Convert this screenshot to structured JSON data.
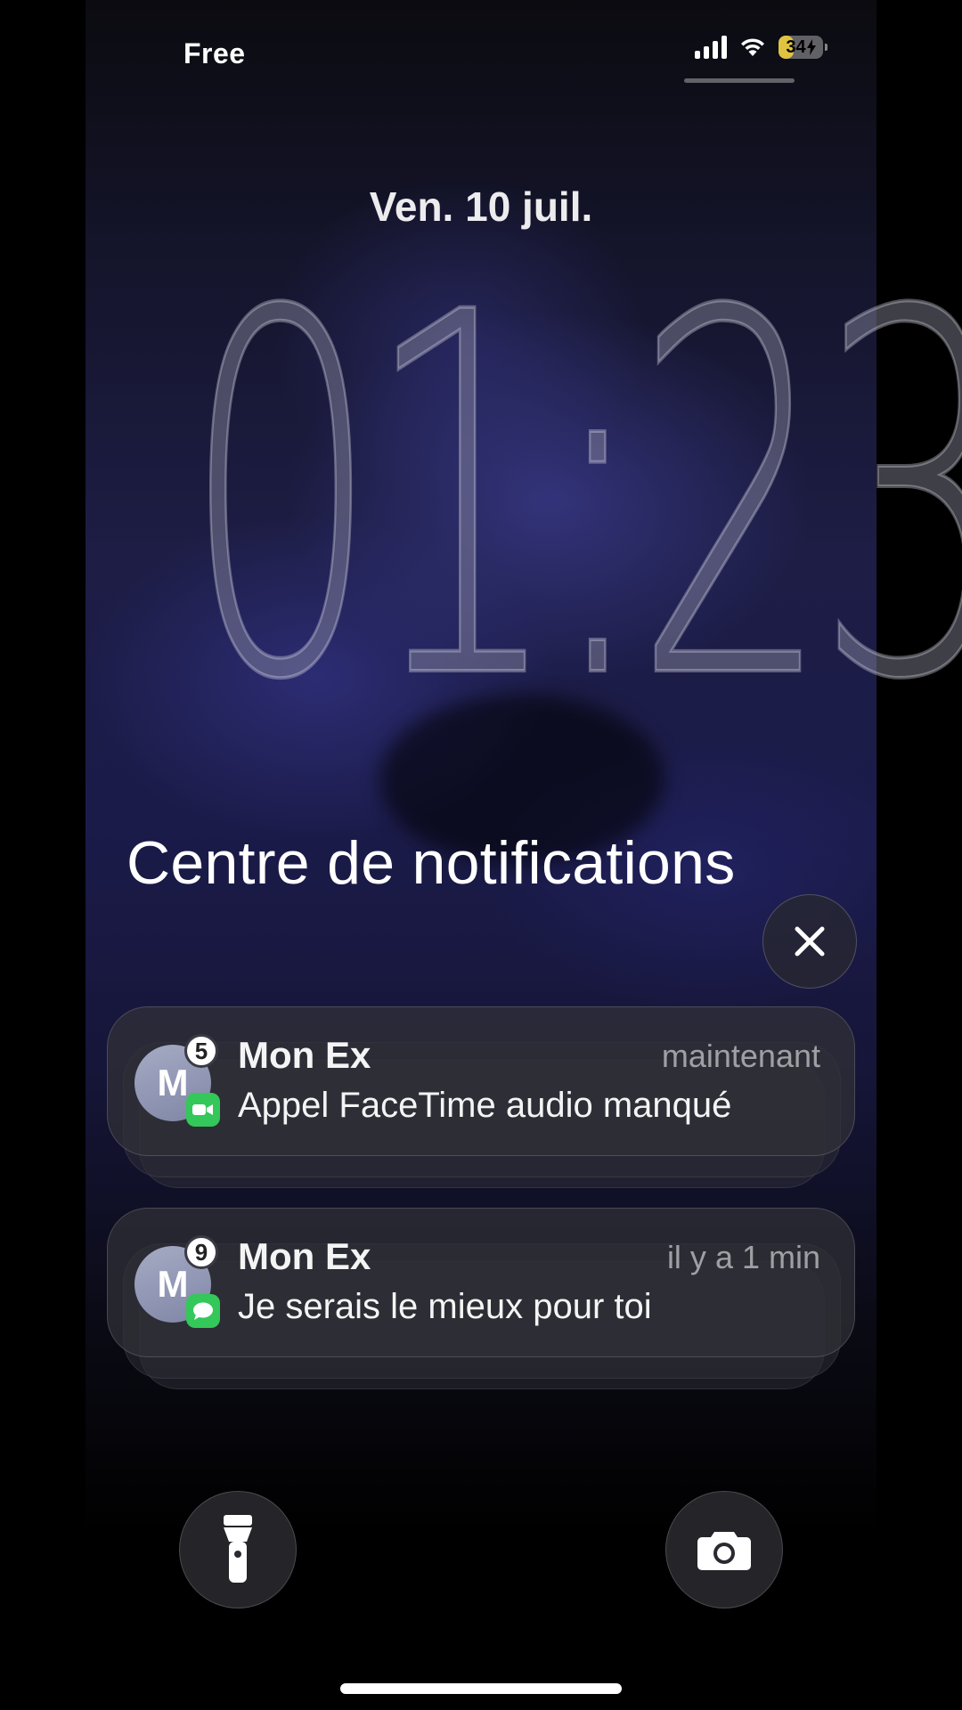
{
  "status_bar": {
    "carrier": "Free",
    "battery_level": "34",
    "battery_fraction": 0.34,
    "battery_color": "#e0c441",
    "charging": true,
    "icons": [
      "signal-icon",
      "wifi-icon",
      "battery-icon",
      "charging-icon"
    ]
  },
  "lock_screen": {
    "date": "Ven. 10 juil.",
    "time": "01:23"
  },
  "notification_center": {
    "title": "Centre de notifications",
    "close_icon": "close-icon"
  },
  "notifications": [
    {
      "avatar_initial": "M",
      "count": "5",
      "sender": "Mon Ex",
      "time": "maintenant",
      "body": "Appel FaceTime audio manqué",
      "app_icon": "facetime-icon",
      "app_color": "#34c759"
    },
    {
      "avatar_initial": "M",
      "count": "9",
      "sender": "Mon Ex",
      "time": "il y a 1 min",
      "body": "Je serais le mieux pour toi",
      "app_icon": "messages-icon",
      "app_color": "#34c759"
    }
  ],
  "quick_actions": {
    "left_icon": "flashlight-icon",
    "right_icon": "camera-icon"
  }
}
